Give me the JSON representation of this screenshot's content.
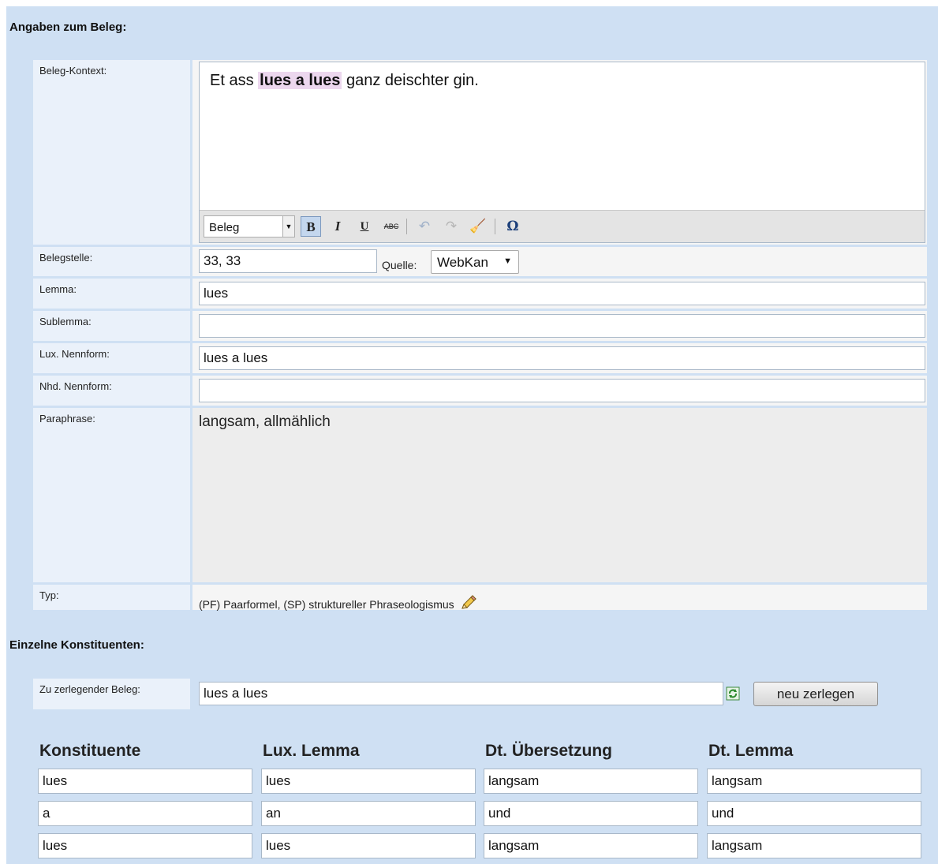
{
  "sections": {
    "angaben_title": "Angaben zum Beleg:",
    "konstituenten_title": "Einzelne Konstituenten:"
  },
  "fields": {
    "kontext_label": "Beleg-Kontext:",
    "kontext_before": "Et ass ",
    "kontext_highlight": "lues a lues",
    "kontext_after": " ganz deischter gin.",
    "belegstelle_label": "Belegstelle:",
    "belegstelle_value": "33, 33",
    "quelle_label": "Quelle:",
    "quelle_value": "WebKan",
    "lemma_label": "Lemma:",
    "lemma_value": "lues",
    "sublemma_label": "Sublemma:",
    "sublemma_value": "",
    "lux_nennform_label": "Lux. Nennform:",
    "lux_nennform_value": "lues a lues",
    "nhd_nennform_label": "Nhd. Nennform:",
    "nhd_nennform_value": "",
    "paraphrase_label": "Paraphrase:",
    "paraphrase_value": "langsam, allmählich",
    "typ_label": "Typ:",
    "typ_value": "(PF) Paarformel, (SP) struktureller Phraseologismus"
  },
  "toolbar": {
    "format_select": "Beleg",
    "bold": "B",
    "italic": "I",
    "underline": "U",
    "strike": "ABC",
    "undo": "↶",
    "redo": "↷",
    "clean": "🧹",
    "omega": "Ω"
  },
  "zerlegen": {
    "label": "Zu zerlegender Beleg:",
    "value": "lues a lues",
    "button": "neu zerlegen"
  },
  "table": {
    "headers": [
      "Konstituente",
      "Lux. Lemma",
      "Dt. Übersetzung",
      "Dt. Lemma"
    ],
    "rows": [
      [
        "lues",
        "lues",
        "langsam",
        "langsam"
      ],
      [
        "a",
        "an",
        "und",
        "und"
      ],
      [
        "lues",
        "lues",
        "langsam",
        "langsam"
      ]
    ]
  },
  "colors": {
    "background": "#cfe0f3",
    "highlight": "#ecd7ee"
  },
  "icons": [
    "pencil-icon",
    "refresh-icon",
    "chevron-down-icon",
    "eraser-icon",
    "omega-icon"
  ]
}
